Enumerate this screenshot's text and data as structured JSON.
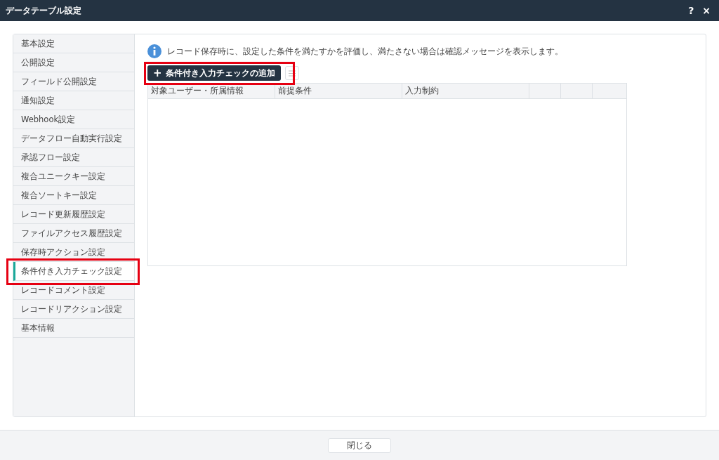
{
  "window": {
    "title": "データテーブル設定",
    "help": "?",
    "close": "×"
  },
  "sidebar": {
    "items": [
      {
        "label": "基本設定",
        "selected": false,
        "highlighted": false
      },
      {
        "label": "公開設定",
        "selected": false,
        "highlighted": false
      },
      {
        "label": "フィールド公開設定",
        "selected": false,
        "highlighted": false
      },
      {
        "label": "通知設定",
        "selected": false,
        "highlighted": false
      },
      {
        "label": "Webhook設定",
        "selected": false,
        "highlighted": false
      },
      {
        "label": "データフロー自動実行設定",
        "selected": false,
        "highlighted": false
      },
      {
        "label": "承認フロー設定",
        "selected": false,
        "highlighted": false
      },
      {
        "label": "複合ユニークキー設定",
        "selected": false,
        "highlighted": false
      },
      {
        "label": "複合ソートキー設定",
        "selected": false,
        "highlighted": false
      },
      {
        "label": "レコード更新履歴設定",
        "selected": false,
        "highlighted": false
      },
      {
        "label": "ファイルアクセス履歴設定",
        "selected": false,
        "highlighted": false
      },
      {
        "label": "保存時アクション設定",
        "selected": false,
        "highlighted": false
      },
      {
        "label": "条件付き入力チェック設定",
        "selected": true,
        "highlighted": true
      },
      {
        "label": "レコードコメント設定",
        "selected": false,
        "highlighted": false
      },
      {
        "label": "レコードリアクション設定",
        "selected": false,
        "highlighted": false
      },
      {
        "label": "基本情報",
        "selected": false,
        "highlighted": false
      }
    ]
  },
  "info": "レコード保存時に、設定した条件を満たすかを評価し、満たさない場合は確認メッセージを表示します。",
  "add_button": {
    "icon": "+",
    "label": "条件付き入力チェックの追加",
    "highlighted": true
  },
  "table": {
    "columns": [
      "対象ユーザー・所属情報",
      "前提条件",
      "入力制約"
    ]
  },
  "footer": {
    "button": "閉じる"
  }
}
